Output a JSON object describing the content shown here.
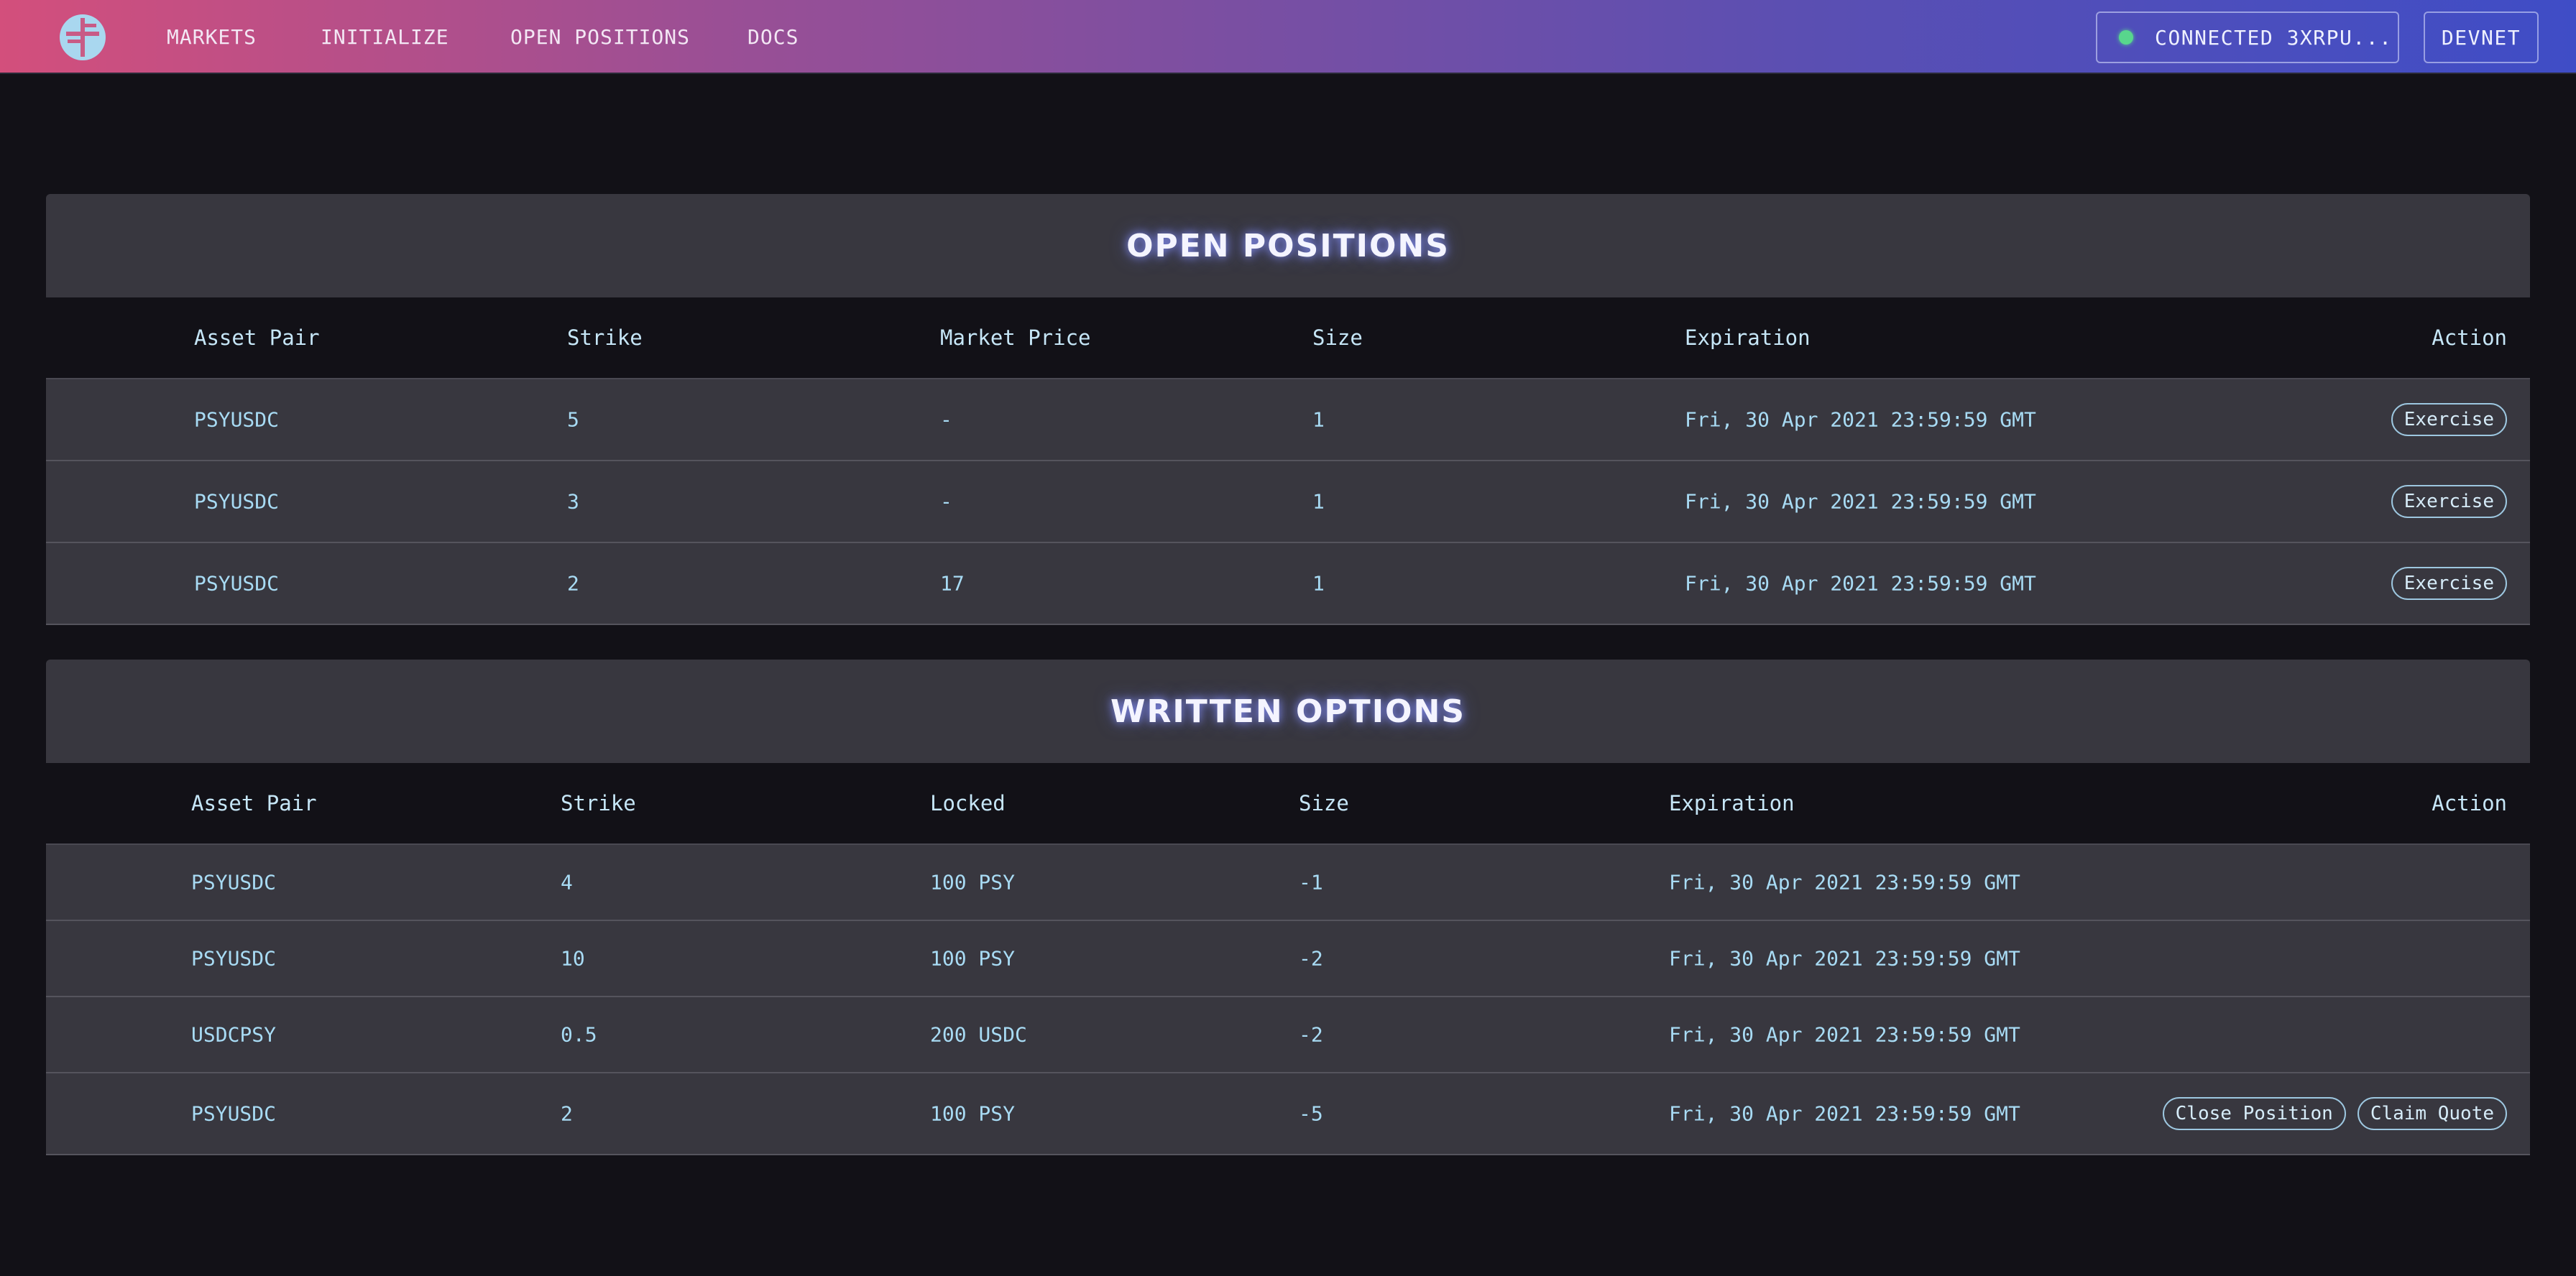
{
  "nav": {
    "items": [
      "MARKETS",
      "INITIALIZE",
      "OPEN POSITIONS",
      "DOCS"
    ],
    "wallet_label": "CONNECTED 3XRPU...",
    "network_label": "DEVNET",
    "status_color": "#58d68d"
  },
  "open_positions": {
    "title": "OPEN POSITIONS",
    "headers": [
      "Asset Pair",
      "Strike",
      "Market Price",
      "Size",
      "Expiration",
      "Action"
    ],
    "rows": [
      {
        "pair": "PSYUSDC",
        "strike": "5",
        "market_price": "-",
        "size": "1",
        "expiration": "Fri, 30 Apr 2021 23:59:59 GMT",
        "action": "Exercise"
      },
      {
        "pair": "PSYUSDC",
        "strike": "3",
        "market_price": "-",
        "size": "1",
        "expiration": "Fri, 30 Apr 2021 23:59:59 GMT",
        "action": "Exercise"
      },
      {
        "pair": "PSYUSDC",
        "strike": "2",
        "market_price": "17",
        "size": "1",
        "expiration": "Fri, 30 Apr 2021 23:59:59 GMT",
        "action": "Exercise"
      }
    ]
  },
  "written_options": {
    "title": "WRITTEN OPTIONS",
    "headers": [
      "Asset Pair",
      "Strike",
      "Locked",
      "Size",
      "Expiration",
      "Action"
    ],
    "rows": [
      {
        "pair": "PSYUSDC",
        "strike": "4",
        "locked": "100 PSY",
        "size": "-1",
        "expiration": "Fri, 30 Apr 2021 23:59:59 GMT",
        "actions": []
      },
      {
        "pair": "PSYUSDC",
        "strike": "10",
        "locked": "100 PSY",
        "size": "-2",
        "expiration": "Fri, 30 Apr 2021 23:59:59 GMT",
        "actions": []
      },
      {
        "pair": "USDCPSY",
        "strike": "0.5",
        "locked": "200 USDC",
        "size": "-2",
        "expiration": "Fri, 30 Apr 2021 23:59:59 GMT",
        "actions": []
      },
      {
        "pair": "PSYUSDC",
        "strike": "2",
        "locked": "100 PSY",
        "size": "-5",
        "expiration": "Fri, 30 Apr 2021 23:59:59 GMT",
        "actions": [
          "Close Position",
          "Claim Quote"
        ]
      }
    ]
  }
}
